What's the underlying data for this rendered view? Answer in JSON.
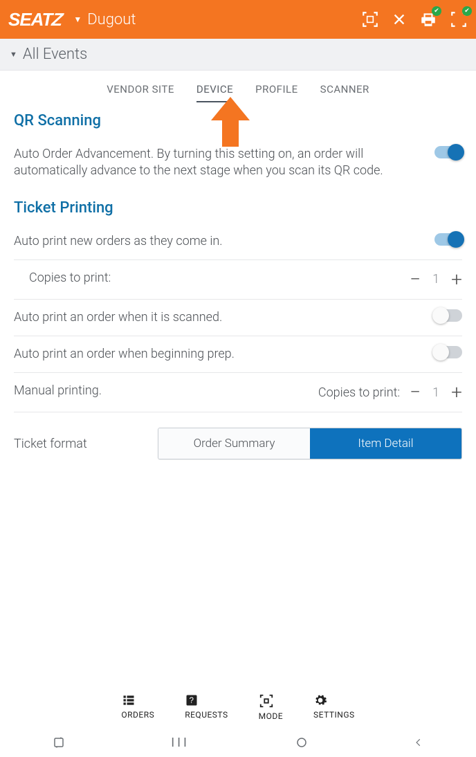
{
  "header": {
    "logo": "SEATZ",
    "venue": "Dugout"
  },
  "subheader": {
    "label": "All Events"
  },
  "tabs": [
    {
      "label": "VENDOR SITE"
    },
    {
      "label": "DEVICE"
    },
    {
      "label": "PROFILE"
    },
    {
      "label": "SCANNER"
    }
  ],
  "qr": {
    "title": "QR Scanning",
    "auto_order_text": "Auto Order Advancement. By turning this setting on, an order will automatically advance to the next stage when you scan its QR code."
  },
  "printing": {
    "title": "Ticket Printing",
    "auto_new_text": "Auto print new orders as they come in.",
    "copies_label": "Copies to print:",
    "copies_value": "1",
    "auto_scanned_text": "Auto print an order when it is scanned.",
    "auto_prep_text": "Auto print an order when beginning prep.",
    "manual_label": "Manual printing.",
    "manual_copies_label": "Copies to print:",
    "manual_copies_value": "1",
    "format_label": "Ticket format",
    "format_options": [
      "Order Summary",
      "Item Detail"
    ]
  },
  "footer": {
    "orders": "ORDERS",
    "requests": "REQUESTS",
    "mode": "MODE",
    "settings": "SETTINGS"
  }
}
